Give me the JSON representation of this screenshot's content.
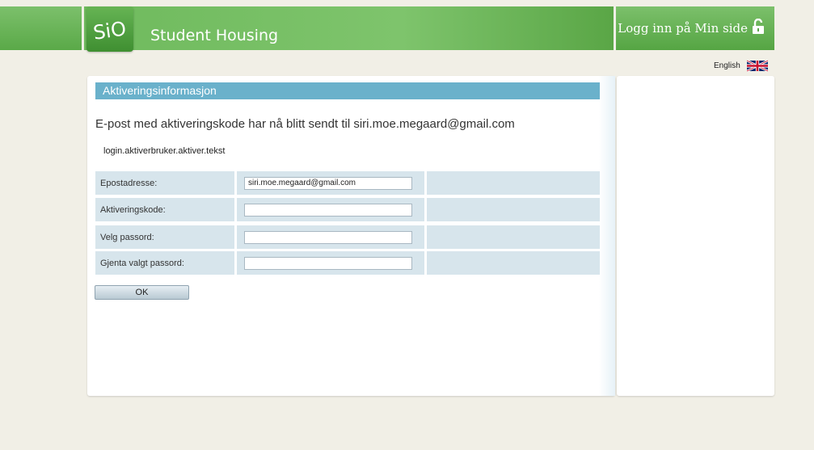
{
  "header": {
    "logo_text": "SiO",
    "title": "Student Housing",
    "login_link": "Logg inn på Min side",
    "brand_color": "#6fba5d"
  },
  "language": {
    "label": "English",
    "flag_icon": "uk-flag-icon"
  },
  "section": {
    "title": "Aktiveringsinformasjon",
    "email_sent_message": "E-post med aktiveringskode har nå blitt sendt til siri.moe.megaard@gmail.com",
    "i18n_key_text": "login.aktiverbruker.aktiver.tekst"
  },
  "form": {
    "fields": [
      {
        "label": "Epostadresse:",
        "value": "siri.moe.megaard@gmail.com"
      },
      {
        "label": "Aktiveringskode:",
        "value": ""
      },
      {
        "label": "Velg passord:",
        "value": ""
      },
      {
        "label": "Gjenta valgt passord:",
        "value": ""
      }
    ],
    "submit_label": "OK"
  }
}
